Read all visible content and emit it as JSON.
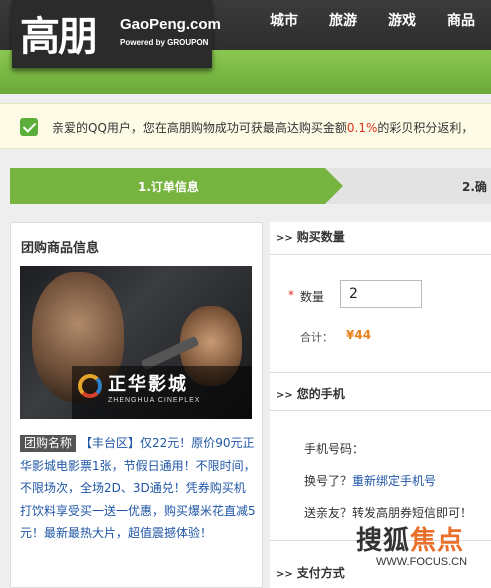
{
  "header": {
    "logo_cn": "高朋",
    "logo_en": "GaoPeng.com",
    "logo_powered": "Powered by GROUPON",
    "nav": [
      "城市",
      "旅游",
      "游戏",
      "商品"
    ]
  },
  "notice": {
    "text_before": "亲爱的QQ用户，您在高朋购物成功可获最高达购买金额",
    "highlight": "0.1%",
    "text_after": "的彩贝积分返利，",
    "accent_color": "#e0301e"
  },
  "steps": [
    {
      "label": "1.订单信息",
      "active": true
    },
    {
      "label": "2.确",
      "active": false
    }
  ],
  "left": {
    "title": "团购商品信息",
    "poster": {
      "cinema_cn": "正华影城",
      "cinema_en": "ZHENGHUA CINEPLEX"
    },
    "tag": "团购名称",
    "link": "【丰台区】仅22元！原价90元正华影城电影票1张，节假日通用！不限时间，不限场次，全场2D、3D通兑！凭券购买机打饮料享受买一送一优惠，购买爆米花直减5元！最新最热大片，超值震撼体验！"
  },
  "right": {
    "buy_section_title": "购买数量",
    "qty_label": "数量",
    "qty_value": "2",
    "total_label": "合计：",
    "total_value": "¥44",
    "phone_section_title": "您的手机",
    "phone_label": "手机号码：",
    "rebind_prefix": "换号了？",
    "rebind_link": "重新绑定手机号",
    "gift_text": "送亲友？转发高朋券短信即可！",
    "pay_section_title": "支付方式",
    "arrows": ">>"
  },
  "watermark": {
    "cn_part1": "搜狐",
    "cn_part2": "焦点",
    "url": "WWW.FOCUS.CN"
  }
}
